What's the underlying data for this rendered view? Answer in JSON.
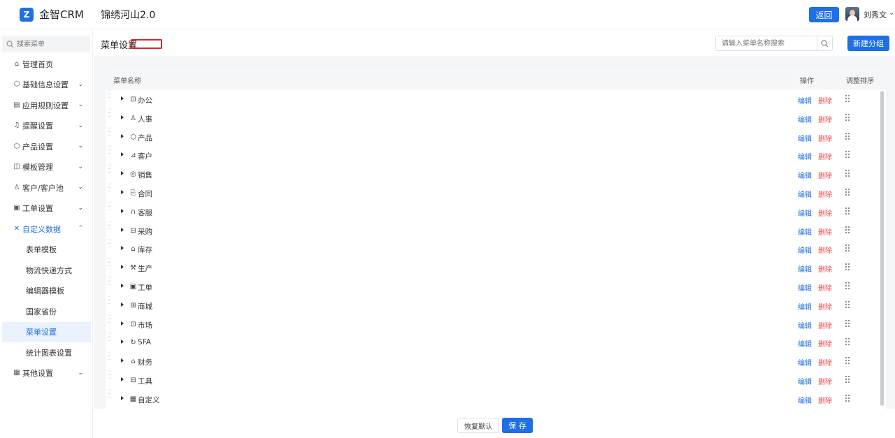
{
  "header": {
    "logo_text": "金智CRM",
    "app_name": "锦绣河山2.0",
    "back_label": "返回",
    "user_name": "刘秀文"
  },
  "sidebar": {
    "search_placeholder": "搜索菜单",
    "items": [
      {
        "label": "管理首页",
        "icon": "home-icon",
        "expandable": false
      },
      {
        "label": "基础信息设置",
        "icon": "shield-icon",
        "expandable": true
      },
      {
        "label": "应用规则设置",
        "icon": "document-icon",
        "expandable": true
      },
      {
        "label": "提醒设置",
        "icon": "bell-icon",
        "expandable": true
      },
      {
        "label": "产品设置",
        "icon": "cube-icon",
        "expandable": true
      },
      {
        "label": "模板管理",
        "icon": "template-icon",
        "expandable": true
      },
      {
        "label": "客户/客户池",
        "icon": "customer-icon",
        "expandable": true
      },
      {
        "label": "工单设置",
        "icon": "ticket-icon",
        "expandable": true
      },
      {
        "label": "自定义数据",
        "icon": "tools-icon",
        "expandable": true,
        "open": true
      }
    ],
    "sub_items": [
      "表单模板",
      "物流快递方式",
      "编辑器模板",
      "国家省份",
      "菜单设置",
      "统计图表设置"
    ],
    "active_sub": "菜单设置",
    "other": {
      "label": "其他设置",
      "icon": "grid-icon"
    }
  },
  "page": {
    "title": "菜单设置",
    "search_placeholder": "请输入菜单名称搜索",
    "new_group_label": "新建分组"
  },
  "table": {
    "col_name": "菜单名称",
    "col_action": "操作",
    "col_sort": "调整排序",
    "edit_label": "编辑",
    "delete_label": "删除",
    "rows": [
      {
        "label": "办公",
        "icon": "office-icon"
      },
      {
        "label": "人事",
        "icon": "people-icon"
      },
      {
        "label": "产品",
        "icon": "cube-icon"
      },
      {
        "label": "客户",
        "icon": "customer-icon"
      },
      {
        "label": "销售",
        "icon": "sales-icon"
      },
      {
        "label": "合同",
        "icon": "contract-icon"
      },
      {
        "label": "客服",
        "icon": "headset-icon"
      },
      {
        "label": "采购",
        "icon": "purchase-icon"
      },
      {
        "label": "库存",
        "icon": "warehouse-icon"
      },
      {
        "label": "生产",
        "icon": "production-icon"
      },
      {
        "label": "工单",
        "icon": "ticket-icon"
      },
      {
        "label": "商城",
        "icon": "store-icon"
      },
      {
        "label": "市场",
        "icon": "market-icon"
      },
      {
        "label": "SFA",
        "icon": "sfa-icon"
      },
      {
        "label": "财务",
        "icon": "finance-icon"
      },
      {
        "label": "工具",
        "icon": "toolbox-icon"
      },
      {
        "label": "自定义",
        "icon": "grid-icon"
      }
    ]
  },
  "footer": {
    "reset_label": "恢复默认",
    "save_label": "保 存"
  },
  "colors": {
    "primary": "#1f6fe5",
    "danger": "#f0474a",
    "highlight_box": "#e0262b"
  }
}
